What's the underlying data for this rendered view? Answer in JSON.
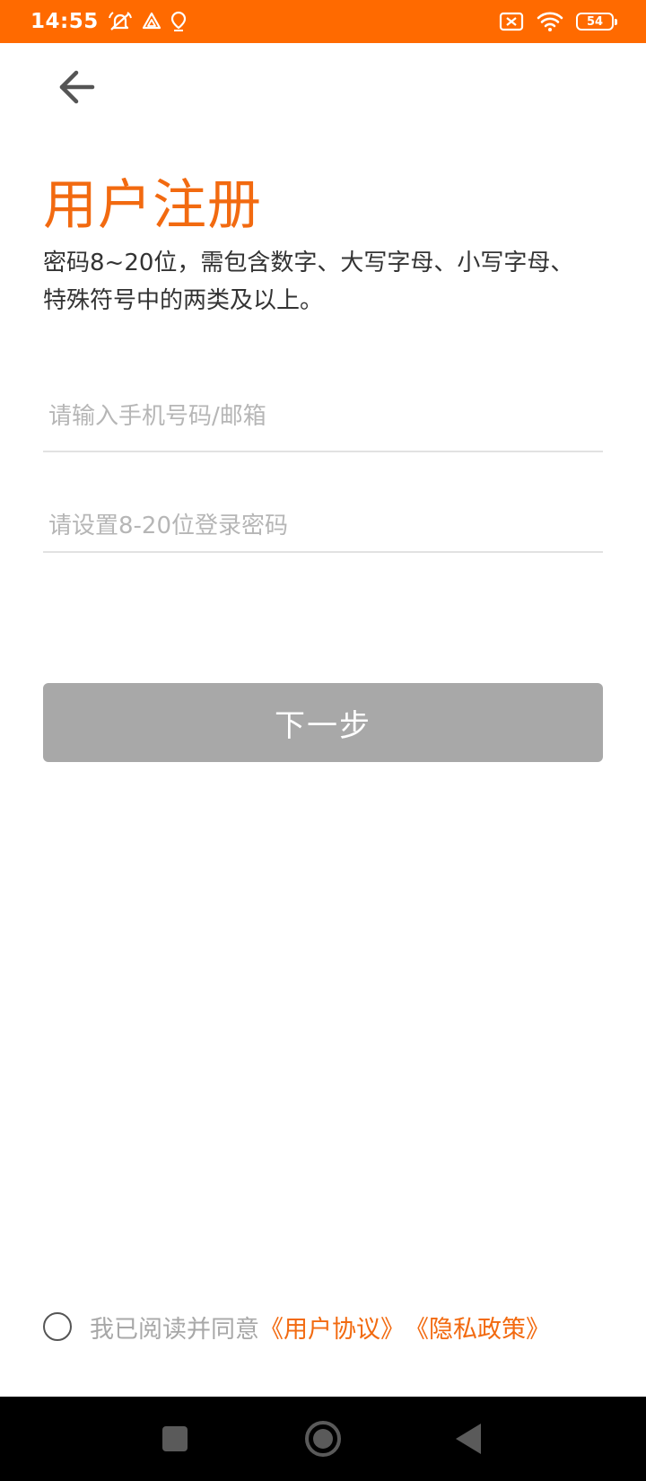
{
  "status_bar": {
    "time": "14:55",
    "battery": "54",
    "background_color": "#ff6a00",
    "icons": [
      "muted-bell-icon",
      "drive-icon",
      "location-icon",
      "sim-no-signal-icon",
      "wifi-icon",
      "battery-icon"
    ]
  },
  "header": {
    "back_icon": "arrow-left-icon"
  },
  "title": "用户注册",
  "description": "密码8~20位，需包含数字、大写字母、小写字母、特殊符号中的两类及以上。",
  "form": {
    "account_placeholder": "请输入手机号码/邮箱",
    "account_value": "",
    "password_placeholder": "请设置8-20位登录密码",
    "password_value": "",
    "next_label": "下一步"
  },
  "agreement": {
    "checked": false,
    "text": "我已阅读并同意",
    "user_agreement": "《用户协议》",
    "privacy_policy": "《隐私政策》"
  },
  "theme": {
    "accent": "#f26a10",
    "button_disabled": "#a8a8a8"
  },
  "nav_bar": {
    "icons": [
      "recents-square-icon",
      "home-circle-icon",
      "back-triangle-icon"
    ]
  }
}
